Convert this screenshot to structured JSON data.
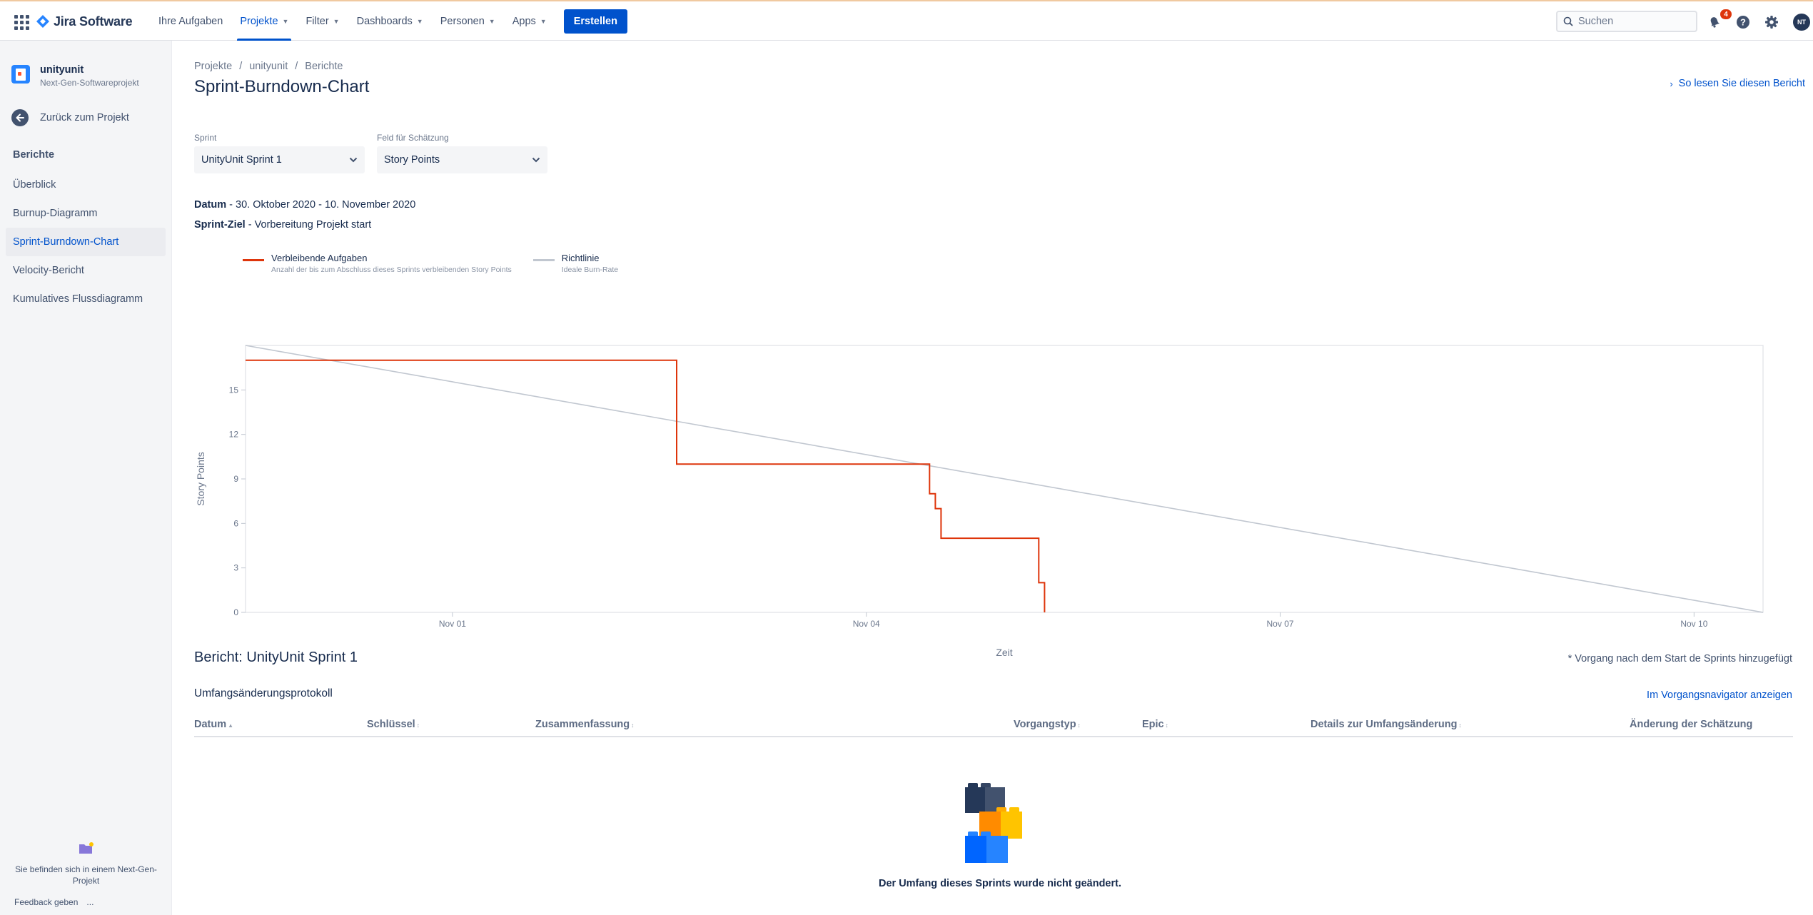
{
  "topnav": {
    "app_name": "Jira Software",
    "items": [
      {
        "label": "Ihre Aufgaben",
        "dropdown": false,
        "active": false
      },
      {
        "label": "Projekte",
        "dropdown": true,
        "active": true
      },
      {
        "label": "Filter",
        "dropdown": true,
        "active": false
      },
      {
        "label": "Dashboards",
        "dropdown": true,
        "active": false
      },
      {
        "label": "Personen",
        "dropdown": true,
        "active": false
      },
      {
        "label": "Apps",
        "dropdown": true,
        "active": false
      }
    ],
    "create_label": "Erstellen",
    "search_placeholder": "Suchen",
    "notifications_count": "4",
    "avatar_initials": "NT",
    "accent_color": "#0052cc"
  },
  "sidebar": {
    "project_name": "unityunit",
    "project_type": "Next-Gen-Softwareprojekt",
    "back_label": "Zurück zum Projekt",
    "section_heading": "Berichte",
    "items": [
      {
        "label": "Überblick",
        "selected": false
      },
      {
        "label": "Burnup-Diagramm",
        "selected": false
      },
      {
        "label": "Sprint-Burndown-Chart",
        "selected": true
      },
      {
        "label": "Velocity-Bericht",
        "selected": false
      },
      {
        "label": "Kumulatives Flussdiagramm",
        "selected": false
      }
    ],
    "nextgen_text": "Sie befinden sich in einem Next-Gen-Projekt",
    "feedback_label": "Feedback geben",
    "more_label": "..."
  },
  "breadcrumb": [
    "Projekte",
    "unityunit",
    "Berichte"
  ],
  "page_title": "Sprint-Burndown-Chart",
  "help_link": "So lesen Sie diesen Bericht",
  "filters": {
    "sprint_label": "Sprint",
    "sprint_value": "UnityUnit Sprint 1",
    "estimate_label": "Feld für Schätzung",
    "estimate_value": "Story Points"
  },
  "sprint_info": {
    "date_label": "Datum",
    "date_value": " - 30. Oktober 2020 - 10. November 2020",
    "goal_label": "Sprint-Ziel",
    "goal_value": " - Vorbereitung Projekt start"
  },
  "legend": [
    {
      "title": "Verbleibende Aufgaben",
      "subtitle": "Anzahl der bis zum Abschluss dieses Sprints verbleibenden Story Points",
      "color": "#de350b"
    },
    {
      "title": "Richtlinie",
      "subtitle": "Ideale Burn-Rate",
      "color": "#c1c7d0"
    }
  ],
  "chart_data": {
    "type": "line",
    "title": "",
    "xlabel": "Zeit",
    "ylabel": "Story Points",
    "ylim": [
      0,
      18
    ],
    "yticks": [
      0,
      3,
      6,
      9,
      12,
      15
    ],
    "xlim": [
      "2020-10-30 12:00",
      "2020-11-10 12:00"
    ],
    "xticks": [
      "Nov 01",
      "Nov 04",
      "Nov 07",
      "Nov 10"
    ],
    "grid": false,
    "series": [
      {
        "name": "Verbleibende Aufgaben",
        "color": "#de350b",
        "step": true,
        "x": [
          "2020-10-30 12:00",
          "2020-11-02 15:00",
          "2020-11-02 15:00",
          "2020-11-04 11:00",
          "2020-11-04 11:00",
          "2020-11-04 12:00",
          "2020-11-04 12:00",
          "2020-11-04 13:00",
          "2020-11-04 13:00",
          "2020-11-05 06:00",
          "2020-11-05 06:00",
          "2020-11-05 07:00",
          "2020-11-05 07:00"
        ],
        "values": [
          17,
          17,
          10,
          10,
          8,
          8,
          7,
          7,
          5,
          5,
          2,
          2,
          0
        ]
      },
      {
        "name": "Richtlinie",
        "color": "#c1c7d0",
        "step": false,
        "x": [
          "2020-10-30 12:00",
          "2020-11-10 12:00"
        ],
        "values": [
          18,
          0
        ]
      }
    ]
  },
  "report": {
    "title": "Bericht: UnityUnit Sprint 1",
    "note": "* Vorgang nach dem Start de Sprints hinzugefügt",
    "scope_title": "Umfangsänderungsprotokoll",
    "navigator_link": "Im Vorgangsnavigator anzeigen",
    "columns": [
      "Datum",
      "Schlüssel",
      "Zusammenfassung",
      "Vorgangstyp",
      "Epic",
      "Details zur Umfangsänderung",
      "Änderung der Schätzung"
    ],
    "empty_message": "Der Umfang dieses Sprints wurde nicht geändert."
  }
}
